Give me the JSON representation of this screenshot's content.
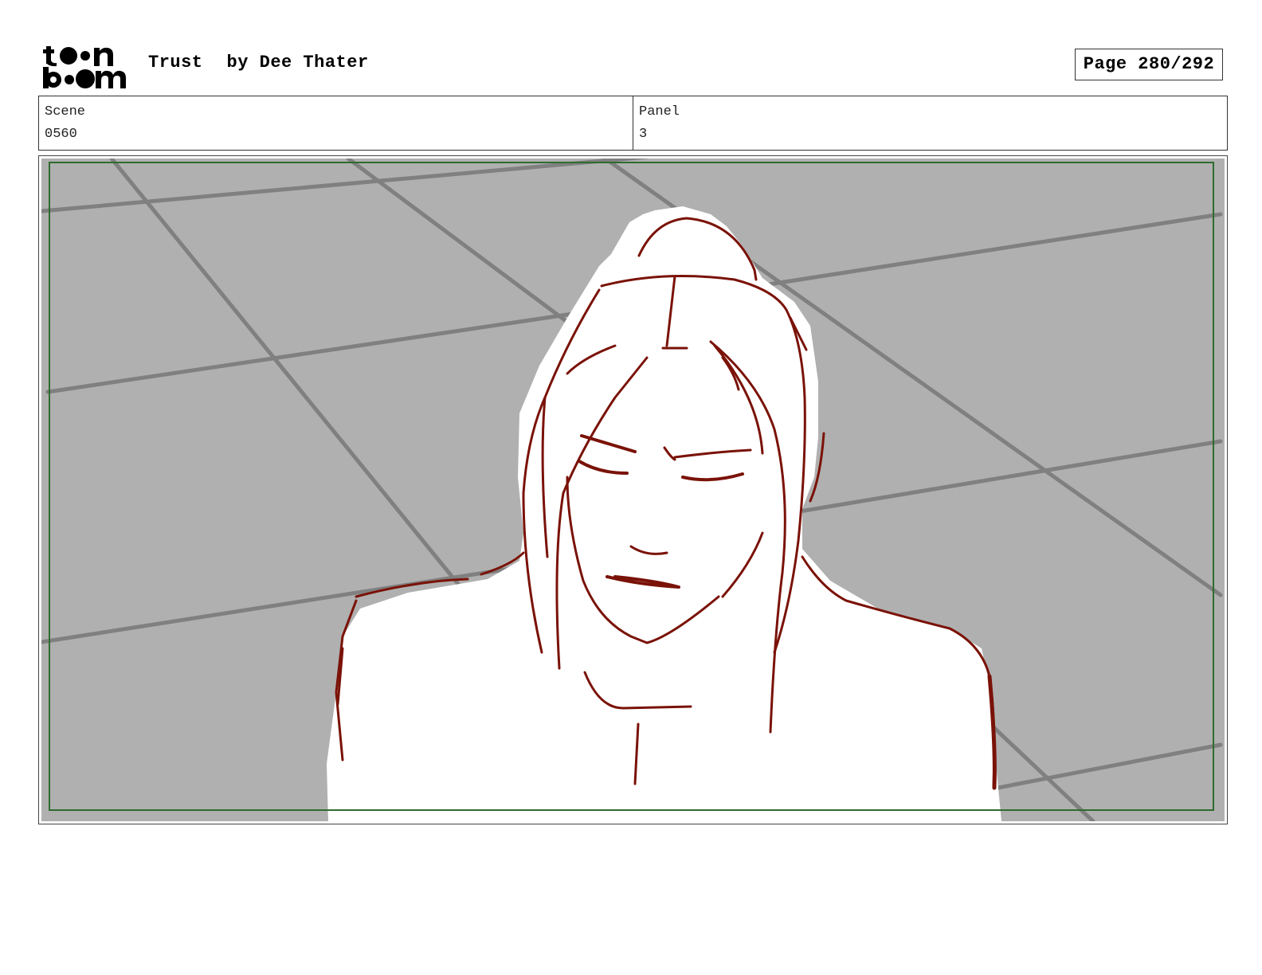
{
  "header": {
    "logo_text": "toon boom",
    "title": "Trust",
    "author": "by Dee Thater",
    "page_label": "Page 280/292"
  },
  "info": {
    "scene_label": "Scene",
    "scene_value": "0560",
    "panel_label": "Panel",
    "panel_value": "3"
  },
  "colors": {
    "floor": "#b0b0b0",
    "grid_lines": "#808080",
    "sketch_lines": "#7a1208",
    "safe_frame": "#2f6b2f"
  }
}
